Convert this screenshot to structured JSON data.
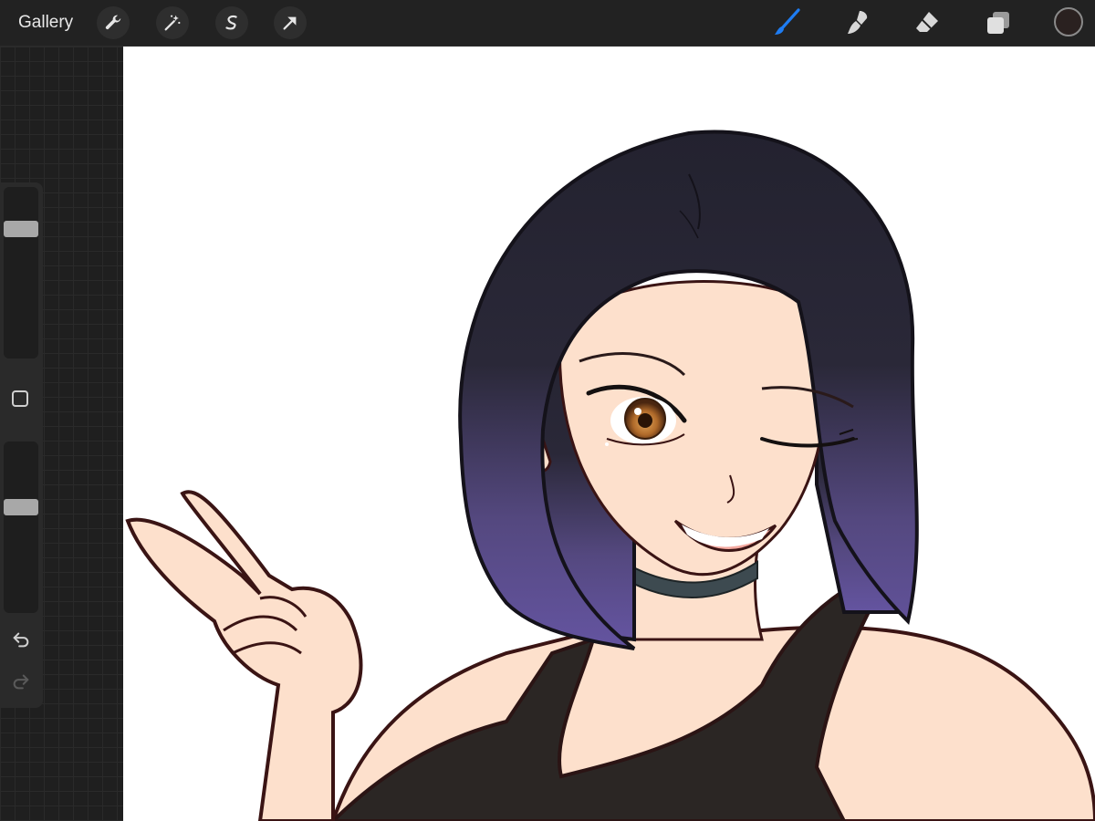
{
  "toolbar": {
    "gallery_label": "Gallery",
    "left_tools": [
      "wrench-icon",
      "magic-wand-icon",
      "selection-icon",
      "transform-arrow-icon"
    ],
    "right_tools": [
      "brush-icon",
      "smudge-icon",
      "eraser-icon",
      "layers-icon"
    ],
    "active_tool": "brush-icon",
    "current_color": "#2a2120"
  },
  "sidebar": {
    "brush_size": 0.78,
    "opacity": 0.63,
    "tools": [
      "modify-square-icon",
      "undo-icon",
      "redo-icon"
    ]
  },
  "canvas": {
    "background": "#ffffff",
    "colors": {
      "hair_dark": "#23222f",
      "hair_light": "#5c4f8e",
      "skin": "#fde0cc",
      "outline": "#3a1414",
      "top": "#2b2624",
      "choker": "#3d4a50",
      "eye": "#b06a2a"
    }
  },
  "colors": {
    "toolbar_bg": "#222222",
    "active_accent": "#1e7cf2",
    "workspace_bg": "#1f1f1f"
  }
}
